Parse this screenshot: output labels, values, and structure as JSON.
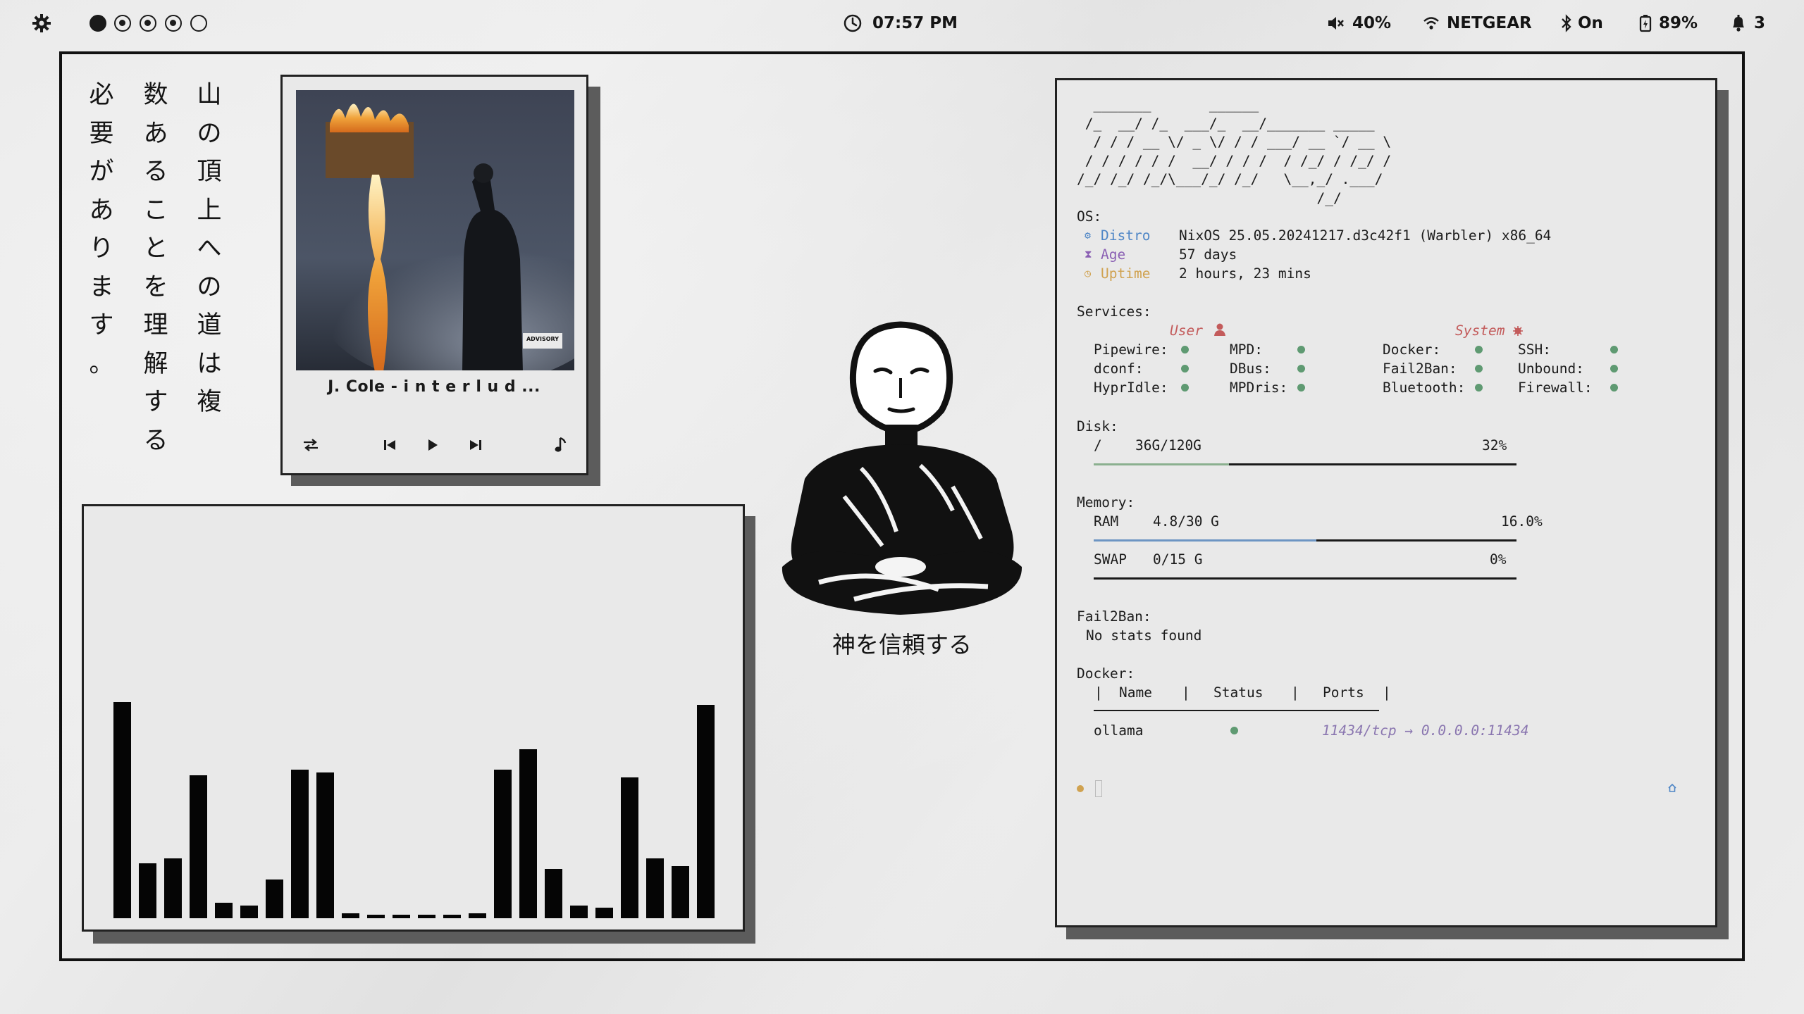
{
  "topbar": {
    "clock": "07:57 PM",
    "volume": "40%",
    "network": "NETGEAR",
    "bluetooth": "On",
    "battery": "89%",
    "notifications": "3",
    "workspaces": [
      "active",
      "dot",
      "dot",
      "dot",
      "empty"
    ]
  },
  "poem": {
    "columns": [
      "山の頂上への道は複",
      "数あることを理解する",
      "必要があります。"
    ]
  },
  "player": {
    "title": "J. Cole - i n t e r l u d ...",
    "advisory": "PARENTAL ADVISORY EXPLICIT CONTENT"
  },
  "visualizer": {
    "levels": [
      0.83,
      0.21,
      0.23,
      0.55,
      0.06,
      0.05,
      0.15,
      0.57,
      0.56,
      0.02,
      0.01,
      0.01,
      0.01,
      0.01,
      0.02,
      0.57,
      0.65,
      0.19,
      0.05,
      0.04,
      0.54,
      0.23,
      0.2,
      0.82
    ]
  },
  "center": {
    "caption": "神を信頼する"
  },
  "terminal": {
    "ascii_logo": [
      "  _______       ______",
      " /_  __/ /_  ___/_  __/_______ _____",
      "  / / / __ \\/ _ \\/ / / ___/ __ `/ __ \\",
      " / / / / / /  __/ / / /  / /_/ / /_/ /",
      "/_/ /_/ /_/\\___/_/ /_/   \\__,_/ .___/",
      "                             /_/"
    ],
    "os_label": "OS:",
    "os": [
      {
        "icon": "⚙",
        "key": "Distro",
        "value": "NixOS 25.05.20241217.d3c42f1 (Warbler) x86_64",
        "color": "#4f86c6"
      },
      {
        "icon": "⧗",
        "key": "Age",
        "value": "57 days",
        "color": "#8a5fb3"
      },
      {
        "icon": "◷",
        "key": "Uptime",
        "value": "2 hours, 23 mins",
        "color": "#d0a250"
      }
    ],
    "services_label": "Services:",
    "user_label": "User",
    "system_label": "System",
    "user_services": [
      "Pipewire:",
      "MPD:",
      "dconf:",
      "DBus:",
      "HyprIdle:",
      "MPDris:"
    ],
    "system_services": [
      "Docker:",
      "SSH:",
      "Fail2Ban:",
      "Unbound:",
      "Bluetooth:",
      "Firewall:"
    ],
    "disk_label": "Disk:",
    "disk": {
      "mount": "/",
      "usage": "36G/120G",
      "percent": "32%",
      "fraction": 0.32
    },
    "memory_label": "Memory:",
    "ram": {
      "label": "RAM",
      "usage": "4.8/30 G",
      "percent": "16.0%",
      "fraction": 0.16
    },
    "swap": {
      "label": "SWAP",
      "usage": "0/15 G",
      "percent": "0%",
      "fraction": 0
    },
    "fail2ban_label": "Fail2Ban:",
    "fail2ban_value": "No stats found",
    "docker_label": "Docker:",
    "docker_headers": [
      "Name",
      "Status",
      "Ports"
    ],
    "docker_rows": [
      {
        "name": "ollama",
        "ports": "11434/tcp → 0.0.0.0:11434"
      }
    ]
  },
  "colors": {
    "ok_green": "#5f9a72",
    "user_red": "#c35b5b",
    "ram_blue": "#6d95c3",
    "disk_green": "#8bb08f",
    "ports_purple": "#8a76b0"
  }
}
